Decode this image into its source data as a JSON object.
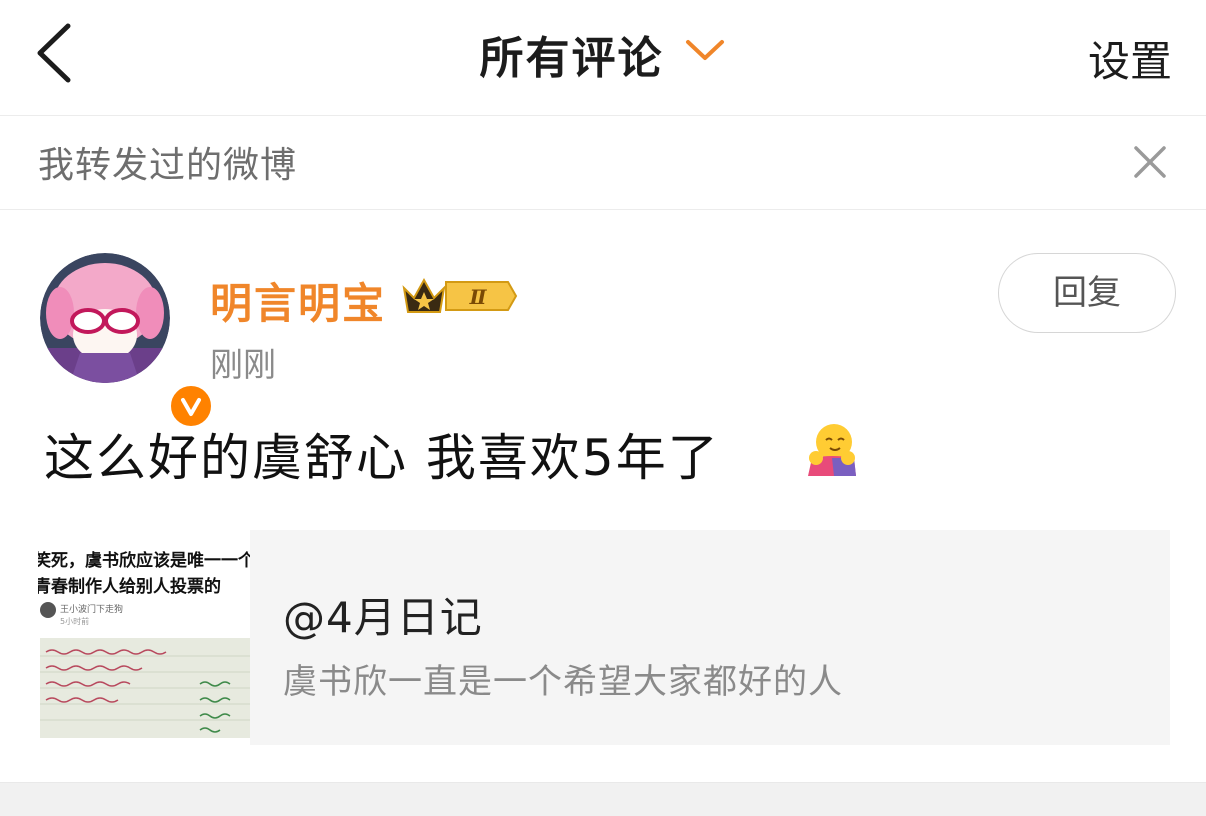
{
  "header": {
    "title": "所有评论",
    "settings_label": "设置"
  },
  "filter": {
    "label": "我转发过的微博"
  },
  "comment": {
    "username": "明言明宝",
    "badge_level": "Ⅱ",
    "timestamp": "刚刚",
    "reply_label": "回复",
    "text": "这么好的虞舒心 我喜欢5年了",
    "quote": {
      "thumb_line1": "笑死，虞书欣应该是唯一一个",
      "thumb_line2": "青春制作人给别人投票的",
      "thumb_user": "王小波门下走狗",
      "thumb_time": "5小时前",
      "title": "@4月日记",
      "description": "虞书欣一直是一个希望大家都好的人"
    }
  },
  "colors": {
    "username": "#f0862a",
    "accent_orange": "#ff8200",
    "chevron": "#f0862a"
  }
}
